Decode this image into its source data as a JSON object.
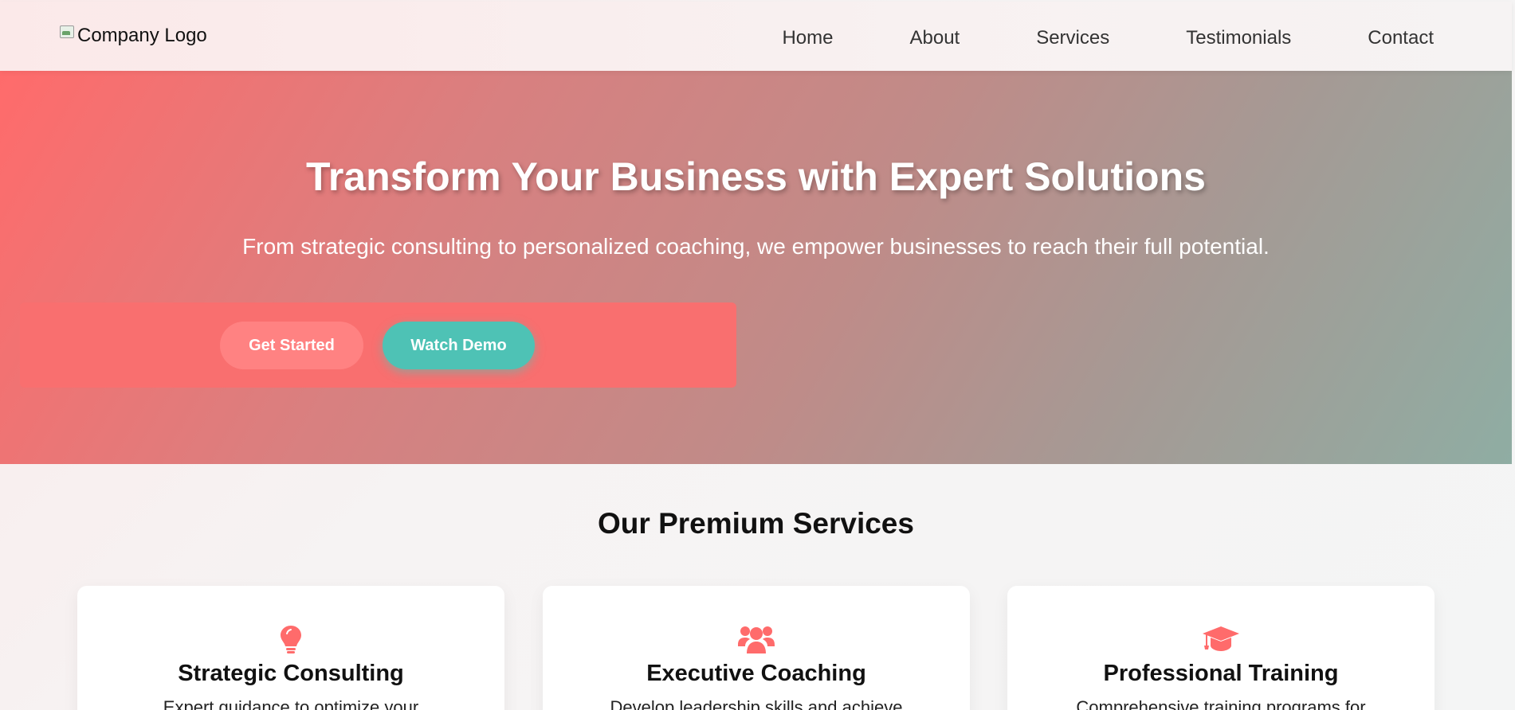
{
  "header": {
    "logo_alt": "Company Logo",
    "nav": [
      "Home",
      "About",
      "Services",
      "Testimonials",
      "Contact"
    ]
  },
  "hero": {
    "title": "Transform Your Business with Expert Solutions",
    "subtitle": "From strategic consulting to personalized coaching, we empower businesses to reach their full potential.",
    "primary_button": "Get Started",
    "secondary_button": "Watch Demo"
  },
  "services": {
    "title": "Our Premium Services",
    "items": [
      {
        "icon": "lightbulb-icon",
        "title": "Strategic Consulting",
        "description": "Expert guidance to optimize your"
      },
      {
        "icon": "users-icon",
        "title": "Executive Coaching",
        "description": "Develop leadership skills and achieve"
      },
      {
        "icon": "graduation-cap-icon",
        "title": "Professional Training",
        "description": "Comprehensive training programs for"
      }
    ]
  },
  "colors": {
    "accent": "#ff6b6b",
    "teal": "#4ec2b5"
  }
}
